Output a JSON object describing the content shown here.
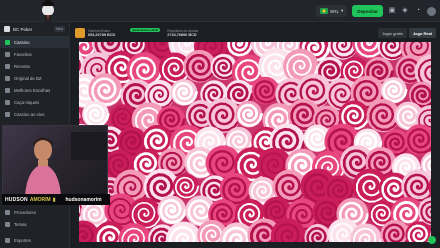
{
  "header": {
    "currency": "BRL",
    "deposit_label": "Depositar",
    "icons": [
      "wallet-icon",
      "gift-icon",
      "bell-icon",
      "user-icon"
    ]
  },
  "sidebar": {
    "brand": "BC Poker",
    "brand_badge": "New",
    "items": [
      {
        "label": "Cassino",
        "icon": "dice-icon"
      },
      {
        "label": "Favoritos",
        "icon": "star-icon"
      },
      {
        "label": "Recente",
        "icon": "clock-icon"
      },
      {
        "label": "Original de BZ",
        "icon": "crown-icon"
      },
      {
        "label": "Melhores Escolhas",
        "icon": "fire-icon"
      },
      {
        "label": "Caça-níqueis",
        "icon": "slot-icon"
      },
      {
        "label": "Cassino ao vivo",
        "icon": "live-icon"
      }
    ],
    "bottom_items": [
      {
        "label": "Provedores",
        "icon": "provider-icon"
      },
      {
        "label": "Temas",
        "icon": "theme-icon"
      },
      {
        "label": "Esportes",
        "icon": "sports-icon"
      }
    ]
  },
  "stream": {
    "name": "HUDSON",
    "name_suffix": "AMORIM",
    "handle": "hudsonamorim",
    "separator": "|"
  },
  "game": {
    "balance_label": "Ganhos Brutos",
    "balance_value": "653,20789 BCD",
    "badge": "ganhe/bônus BCD",
    "bet_label": "Requisitos de Aposta",
    "bet_value": "2743,76806 BCD",
    "free_play_label": "Jogar grátis",
    "real_play_label": "Jogo Real"
  }
}
